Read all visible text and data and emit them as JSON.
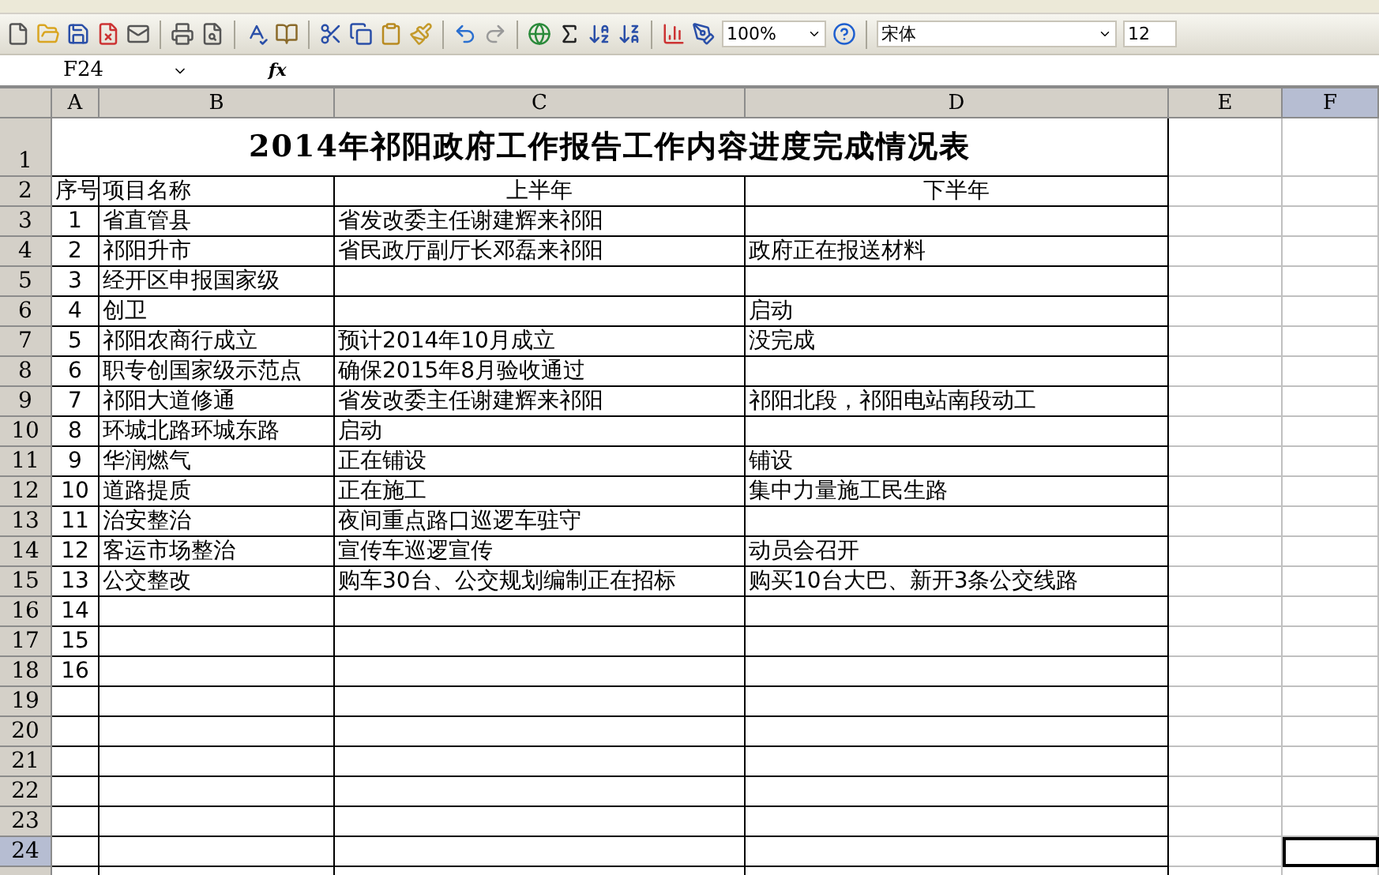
{
  "toolbar": {
    "zoom": "100%",
    "font": "宋体",
    "font_size": "12"
  },
  "formula_bar": {
    "name_box": "F24",
    "fx": "fx"
  },
  "columns": [
    {
      "label": "A",
      "selected": false
    },
    {
      "label": "B",
      "selected": false
    },
    {
      "label": "C",
      "selected": false
    },
    {
      "label": "D",
      "selected": false
    },
    {
      "label": "E",
      "selected": false
    },
    {
      "label": "F",
      "selected": true
    }
  ],
  "title_row_number": "1",
  "title": "2014年祁阳政府工作报告工作内容进度完成情况表",
  "rows": [
    {
      "number": "2",
      "kind": "header",
      "selected": false,
      "cells": [
        "序号",
        "项目名称",
        "上半年",
        "下半年"
      ]
    },
    {
      "number": "3",
      "kind": "data",
      "selected": false,
      "cells": [
        "1",
        "省直管县",
        "省发改委主任谢建辉来祁阳",
        ""
      ]
    },
    {
      "number": "4",
      "kind": "data",
      "selected": false,
      "cells": [
        "2",
        "祁阳升市",
        "省民政厅副厅长邓磊来祁阳",
        "政府正在报送材料"
      ]
    },
    {
      "number": "5",
      "kind": "data",
      "selected": false,
      "cells": [
        "3",
        "经开区申报国家级",
        "",
        ""
      ]
    },
    {
      "number": "6",
      "kind": "data",
      "selected": false,
      "cells": [
        "4",
        "创卫",
        "",
        "启动"
      ]
    },
    {
      "number": "7",
      "kind": "data",
      "selected": false,
      "cells": [
        "5",
        "祁阳农商行成立",
        "预计2014年10月成立",
        "没完成"
      ]
    },
    {
      "number": "8",
      "kind": "data",
      "selected": false,
      "cells": [
        "6",
        "职专创国家级示范点",
        "确保2015年8月验收通过",
        ""
      ]
    },
    {
      "number": "9",
      "kind": "data",
      "selected": false,
      "cells": [
        "7",
        "祁阳大道修通",
        "省发改委主任谢建辉来祁阳",
        "祁阳北段，祁阳电站南段动工"
      ]
    },
    {
      "number": "10",
      "kind": "data",
      "selected": false,
      "cells": [
        "8",
        "环城北路环城东路",
        "启动",
        ""
      ]
    },
    {
      "number": "11",
      "kind": "data",
      "selected": false,
      "cells": [
        "9",
        "华润燃气",
        "正在铺设",
        "铺设"
      ]
    },
    {
      "number": "12",
      "kind": "data",
      "selected": false,
      "cells": [
        "10",
        "道路提质",
        "正在施工",
        "集中力量施工民生路"
      ]
    },
    {
      "number": "13",
      "kind": "data",
      "selected": false,
      "cells": [
        "11",
        "治安整治",
        "夜间重点路口巡逻车驻守",
        ""
      ]
    },
    {
      "number": "14",
      "kind": "data",
      "selected": false,
      "cells": [
        "12",
        "客运市场整治",
        "宣传车巡逻宣传",
        "动员会召开"
      ]
    },
    {
      "number": "15",
      "kind": "data",
      "selected": false,
      "cells": [
        "13",
        "公交整改",
        "购车30台、公交规划编制正在招标",
        "购买10台大巴、新开3条公交线路"
      ]
    },
    {
      "number": "16",
      "kind": "data",
      "selected": false,
      "cells": [
        "14",
        "",
        "",
        ""
      ]
    },
    {
      "number": "17",
      "kind": "data",
      "selected": false,
      "cells": [
        "15",
        "",
        "",
        ""
      ]
    },
    {
      "number": "18",
      "kind": "data",
      "selected": false,
      "cells": [
        "16",
        "",
        "",
        ""
      ]
    },
    {
      "number": "19",
      "kind": "data",
      "selected": false,
      "cells": [
        "",
        "",
        "",
        ""
      ]
    },
    {
      "number": "20",
      "kind": "data",
      "selected": false,
      "cells": [
        "",
        "",
        "",
        ""
      ]
    },
    {
      "number": "21",
      "kind": "data",
      "selected": false,
      "cells": [
        "",
        "",
        "",
        ""
      ]
    },
    {
      "number": "22",
      "kind": "data",
      "selected": false,
      "cells": [
        "",
        "",
        "",
        ""
      ]
    },
    {
      "number": "23",
      "kind": "data",
      "selected": false,
      "cells": [
        "",
        "",
        "",
        ""
      ]
    },
    {
      "number": "24",
      "kind": "data",
      "selected": true,
      "cells": [
        "",
        "",
        "",
        ""
      ]
    }
  ]
}
